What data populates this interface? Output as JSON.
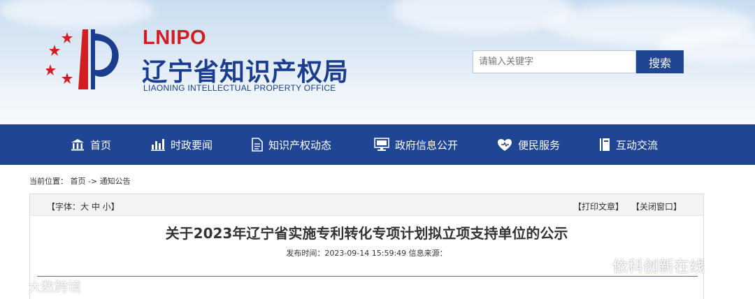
{
  "header": {
    "brand_en": "LNIPO",
    "brand_cn": "辽宁省知识产权局",
    "brand_sub": "LIAONING INTELLECTUAL PROPERTY OFFICE",
    "logo_icon": "lnipo-logo",
    "colors": {
      "brand_red": "#d21e23",
      "brand_blue": "#1a3d8f"
    }
  },
  "search": {
    "placeholder": "请输入关键字",
    "button_label": "搜索"
  },
  "nav": {
    "background": "#1f4593",
    "items": [
      {
        "label": "首页",
        "icon": "home-icon"
      },
      {
        "label": "时政要闻",
        "icon": "bar-chart-icon"
      },
      {
        "label": "知识产权动态",
        "icon": "document-icon"
      },
      {
        "label": "政府信息公开",
        "icon": "monitor-icon"
      },
      {
        "label": "便民服务",
        "icon": "heart-icon"
      },
      {
        "label": "互动交流",
        "icon": "book-icon"
      }
    ]
  },
  "breadcrumb": {
    "text": "当前位置： 首页 -> 通知公告"
  },
  "article": {
    "font_size": "【字体：大 中 小】",
    "print": "【打印文章】",
    "close": "【关闭窗口】",
    "title": "关于2023年辽宁省实施专利转化专项计划拟立项支持单位的公示",
    "meta": "发布时间：2023-09-14 15:59:49   信息来源："
  },
  "watermarks": {
    "left": "大数跨境",
    "right": "依科创新在线"
  }
}
